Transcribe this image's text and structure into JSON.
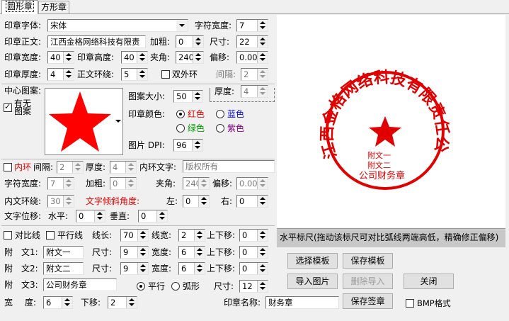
{
  "tabs": [
    {
      "label": "圆形章"
    },
    {
      "label": "方形章"
    }
  ],
  "font": {
    "label": "印章字体:",
    "value": "宋体"
  },
  "char_width": {
    "label": "字符宽度:",
    "value": "7"
  },
  "text": {
    "label": "印章正文:",
    "value": "江西金格网络科技有限责"
  },
  "bold": {
    "label": "加粗:",
    "value": "0"
  },
  "size": {
    "label": "尺寸:",
    "value": "22"
  },
  "seal_width": {
    "label": "印章宽度:",
    "value": "40"
  },
  "seal_height": {
    "label": "印章高度:",
    "value": "40"
  },
  "angle": {
    "label": "夹角:",
    "value": "240"
  },
  "offset": {
    "label": "偏移:",
    "value": "0.000"
  },
  "thickness": {
    "label": "印章厚度:",
    "value": "4"
  },
  "text_ring": {
    "label": "正文环绕:",
    "value": "5"
  },
  "double_ring": {
    "label": "双外环"
  },
  "gap": {
    "label": "间隔:",
    "value": "2"
  },
  "thickness2": {
    "label": "厚度:",
    "value": "4"
  },
  "center": {
    "label": "中心图案:",
    "none_label": "有无图案"
  },
  "pattern_size": {
    "label": "图案大小:",
    "value": "50"
  },
  "color": {
    "label": "印章颜色:",
    "red": "红色",
    "blue": "蓝色",
    "green": "绿色",
    "purple": "紫色"
  },
  "dpi": {
    "label": "图片 DPI:",
    "value": "96"
  },
  "inner": {
    "label": "内环",
    "gap_label": "间隔:",
    "gap": "2",
    "thick_label": "厚度:",
    "thick": "4",
    "text_label": "内环文字:",
    "text": "版权所有"
  },
  "inner2": {
    "char_width_label": "字符宽度:",
    "char_width": "7",
    "bold_label": "加粗:",
    "bold": "0",
    "angle_label": "夹角:",
    "angle": "240",
    "offset_label": "偏移:",
    "offset": "0.000"
  },
  "inner3": {
    "ring_label": "内文环绕:",
    "ring": "30",
    "tilt_label": "文字倾斜角度:",
    "left_label": "左:",
    "left": "0",
    "right_label": "右:",
    "right": "0"
  },
  "pos": {
    "label": "文字位移:",
    "h_label": "水平:",
    "h": "0",
    "v_label": "垂直:",
    "v": "0"
  },
  "line": {
    "compare": "对比线",
    "parallel": "平行线",
    "len_label": "线长:",
    "len": "70",
    "w_label": "线宽:",
    "w": "2",
    "move_label": "上下移:",
    "move": "0"
  },
  "att1": {
    "label1": "附",
    "label2": "文1:",
    "value": "附文一",
    "size_label": "尺寸:",
    "size": "9",
    "w_label": "宽度:",
    "w": "6",
    "move_label": "上下移:",
    "move": "0"
  },
  "att2": {
    "label1": "附",
    "label2": "文2:",
    "value": "附文二",
    "size_label": "尺寸:",
    "size": "9",
    "w_label": "宽度:",
    "w": "6",
    "move_label": "上下移:",
    "move": "0"
  },
  "att3": {
    "label1": "附",
    "label2": "文3:",
    "value": "公司财务章",
    "parallel": "平行",
    "arc": "弧形",
    "size_label": "尺寸:",
    "size": "12"
  },
  "bottom": {
    "w_label1": "宽",
    "w_label2": "度:",
    "w": "6",
    "move_label": "下移:",
    "move": "2",
    "name_label": "印章名称:",
    "name": "财务章"
  },
  "ruler": {
    "text": "水平标尺(拖动该标尺可对比弧线两端高低，精确修正偏移)"
  },
  "buttons": {
    "select_tpl": "选择模板",
    "save_tpl": "保存模板",
    "import_img": "导入图片",
    "delete_import": "删除导入",
    "close": "关闭",
    "save_sign": "保存签章",
    "bmp": "BMP格式"
  },
  "seal": {
    "text": "江西金格网络科技有限责任公司",
    "att1": "附文一",
    "att2": "附文二",
    "att3": "公司财务章",
    "color": "#e00000"
  }
}
